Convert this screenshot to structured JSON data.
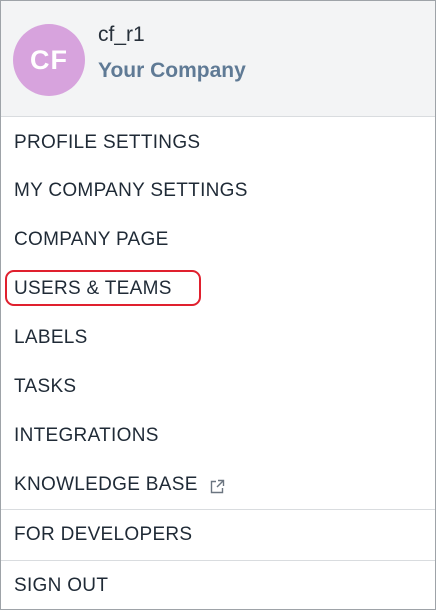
{
  "account": {
    "avatar_initials": "CF",
    "avatar_color": "#d7a3dd",
    "username": "cf_r1",
    "company": "Your Company"
  },
  "menu": {
    "profile_settings": "PROFILE SETTINGS",
    "my_company_settings": "MY COMPANY SETTINGS",
    "company_page": "COMPANY PAGE",
    "users_teams": "USERS & TEAMS",
    "labels": "LABELS",
    "tasks": "TASKS",
    "integrations": "INTEGRATIONS",
    "knowledge_base": "KNOWLEDGE BASE",
    "knowledge_base_icon": "external-link-icon",
    "for_developers": "FOR DEVELOPERS",
    "sign_out": "SIGN OUT"
  },
  "highlight_color": "#e0202e"
}
